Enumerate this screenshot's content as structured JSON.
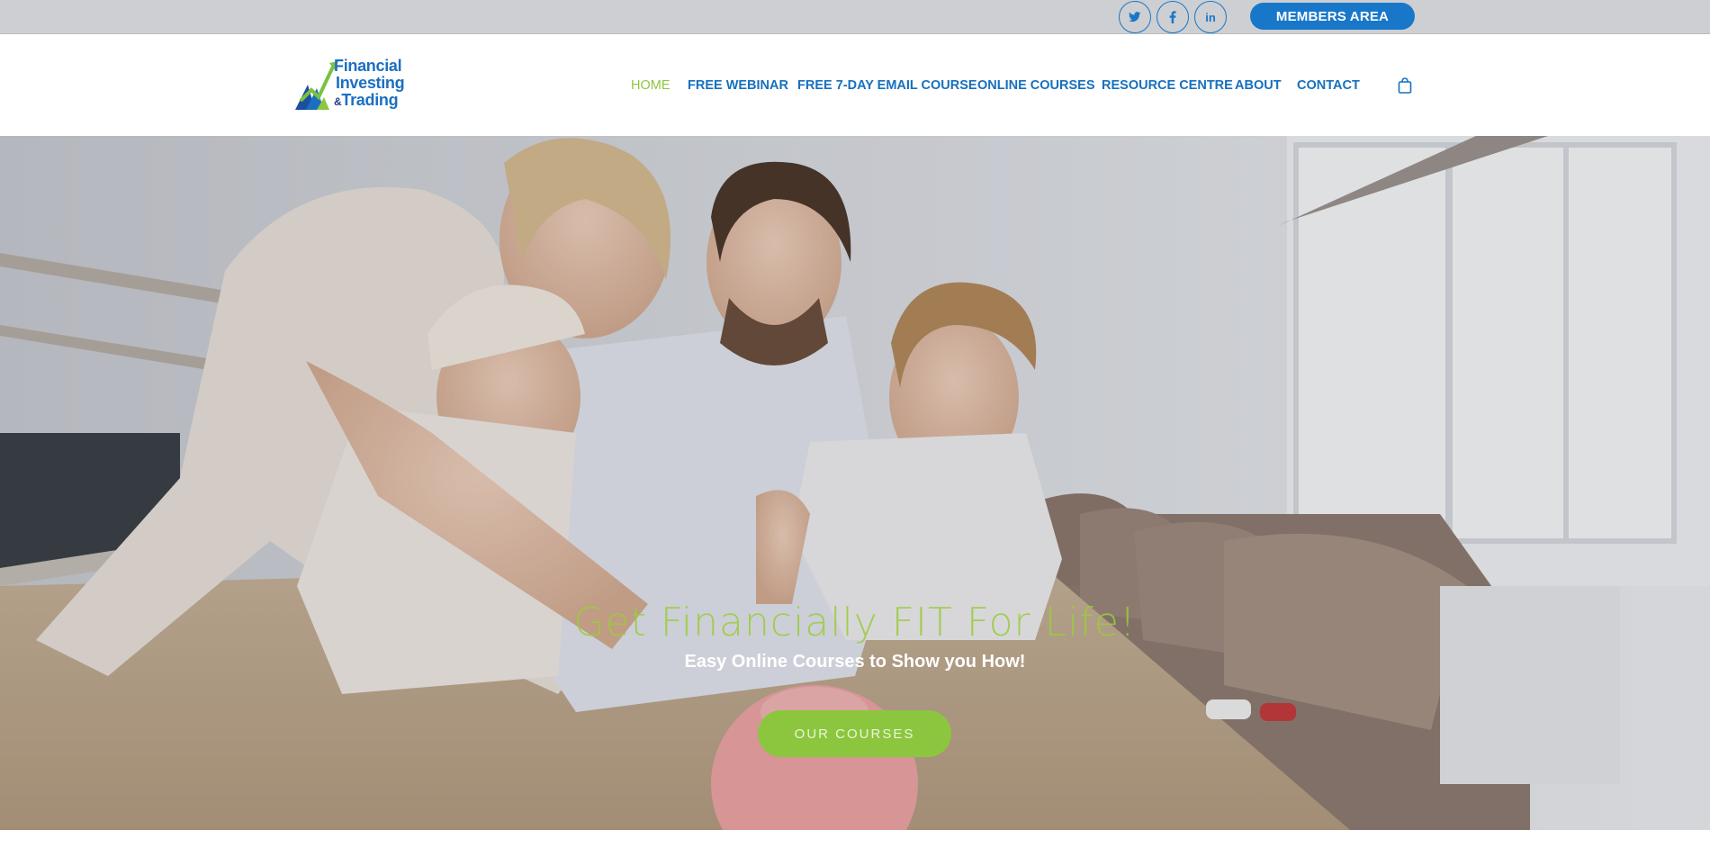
{
  "topbar": {
    "social": [
      {
        "icon": "twitter-icon",
        "glyph": "𝕥"
      },
      {
        "icon": "facebook-icon",
        "glyph": "f"
      },
      {
        "icon": "linkedin-icon",
        "glyph": "in"
      }
    ],
    "members_label": "MEMBERS AREA"
  },
  "logo": {
    "line1": "Financial",
    "line2": "Investing",
    "line3": "Trading",
    "ampersand": "&"
  },
  "nav": {
    "items": [
      {
        "label": "HOME",
        "active": true
      },
      {
        "label": "FREE WEBINAR"
      },
      {
        "label": "FREE 7-DAY EMAIL COURSE"
      },
      {
        "label": "ONLINE COURSES"
      },
      {
        "label": "RESOURCE CENTRE"
      },
      {
        "label": "ABOUT"
      },
      {
        "label": "CONTACT"
      }
    ],
    "cart_icon": "shopping-bag-icon"
  },
  "hero": {
    "title": "Get Financially FIT For Life!",
    "subtitle": "Easy Online Courses to Show you How!",
    "button_label": "OUR COURSES"
  },
  "colors": {
    "brand_blue": "#1770be",
    "brand_green": "#8cc63e",
    "topbar_bg": "#cdcfd2"
  }
}
